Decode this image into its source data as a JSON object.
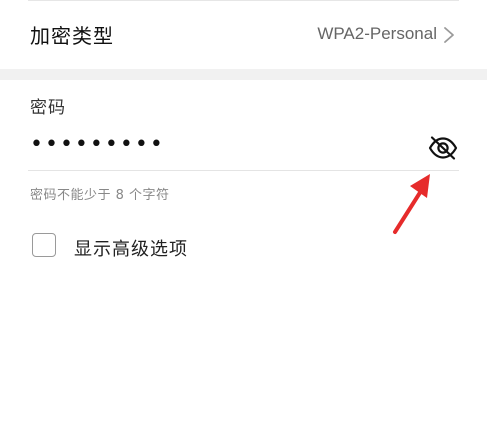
{
  "encryption": {
    "label": "加密类型",
    "value": "WPA2-Personal"
  },
  "password": {
    "label": "密码",
    "masked_value": "•••••••••",
    "hint": "密码不能少于 8 个字符"
  },
  "advanced": {
    "label": "显示高级选项",
    "checked": false
  },
  "colors": {
    "annotation_arrow": "#e62b2b",
    "section_gap": "#f1f1f1"
  }
}
